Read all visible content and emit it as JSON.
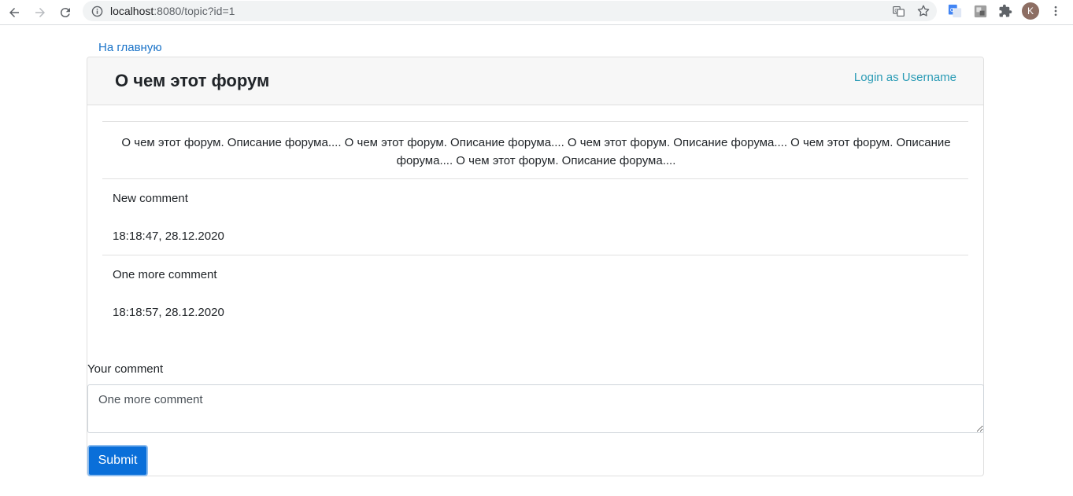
{
  "browser": {
    "url_host": "localhost",
    "url_rest": ":8080/topic?id=1",
    "avatar_letter": "K"
  },
  "page": {
    "home_link": "На главную",
    "title": "О чем этот форум",
    "login_link": "Login as Username",
    "description": "О чем этот форум. Описание форума.... О чем этот форум. Описание форума.... О чем этот форум. Описание форума.... О чем этот форум. Описание форума.... О чем этот форум. Описание форума...."
  },
  "comments": [
    {
      "text": "New comment",
      "time": "18:18:47, 28.12.2020"
    },
    {
      "text": "One more comment",
      "time": "18:18:57, 28.12.2020"
    }
  ],
  "form": {
    "label": "Your comment",
    "value": "One more comment",
    "submit_label": "Submit"
  },
  "colors": {
    "link": "#1a73c8",
    "login_link": "#2a9bb5",
    "button": "#0a6fd9",
    "header_bg": "#f7f7f7"
  }
}
